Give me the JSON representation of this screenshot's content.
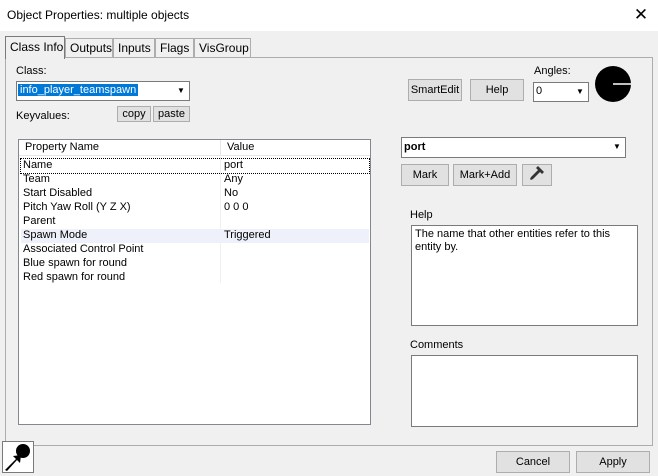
{
  "window": {
    "title": "Object Properties: multiple objects",
    "close_glyph": "✕"
  },
  "tabs": [
    {
      "label": "Class Info",
      "active": true
    },
    {
      "label": "Outputs"
    },
    {
      "label": "Inputs"
    },
    {
      "label": "Flags"
    },
    {
      "label": "VisGroup"
    }
  ],
  "class_section": {
    "label": "Class:",
    "value": "info_player_teamspawn",
    "keyvalues_label": "Keyvalues:",
    "copy_label": "copy",
    "paste_label": "paste"
  },
  "top_right": {
    "smartedit_label": "SmartEdit",
    "help_label": "Help",
    "angles_label": "Angles:",
    "angles_value": "0"
  },
  "grid": {
    "col_property": "Property Name",
    "col_value": "Value",
    "rows": [
      {
        "name": "Name",
        "value": "port"
      },
      {
        "name": "Team",
        "value": "Any"
      },
      {
        "name": "Start Disabled",
        "value": "No"
      },
      {
        "name": "Pitch Yaw Roll (Y Z X)",
        "value": "0 0 0"
      },
      {
        "name": "Parent",
        "value": ""
      },
      {
        "name": "Spawn Mode",
        "value": "Triggered"
      },
      {
        "name": "Associated Control Point",
        "value": ""
      },
      {
        "name": "Blue spawn for round",
        "value": ""
      },
      {
        "name": "Red spawn for round",
        "value": ""
      }
    ]
  },
  "value_editor": {
    "value": "port",
    "mark_label": "Mark",
    "mark_add_label": "Mark+Add",
    "eyedropper_icon": "eyedropper-icon"
  },
  "help_section": {
    "label": "Help",
    "text": "The name that other entities refer to this entity by."
  },
  "comments_section": {
    "label": "Comments",
    "text": ""
  },
  "footer": {
    "cancel_label": "Cancel",
    "apply_label": "Apply"
  },
  "colors": {
    "selection": "#0078d7",
    "row_highlight": "#eef1f9",
    "dialog_bg": "#f0f0f0"
  }
}
